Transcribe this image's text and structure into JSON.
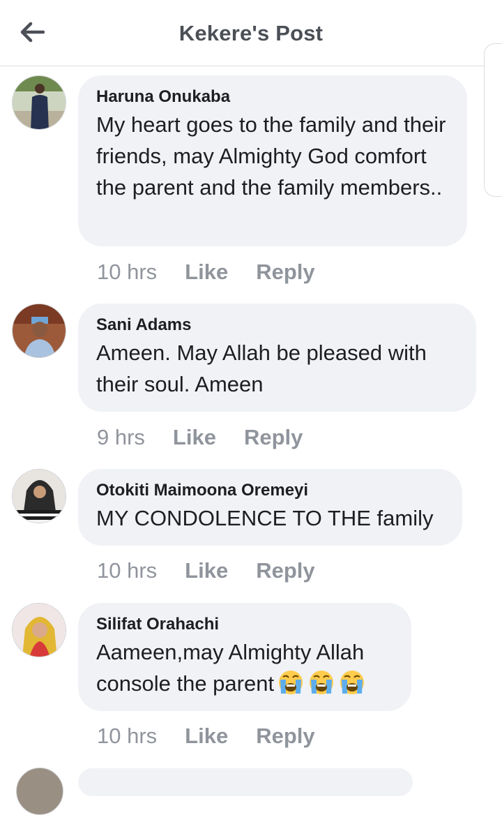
{
  "header": {
    "title": "Kekere's Post",
    "back_icon": "arrow-left-icon"
  },
  "actions": {
    "like": "Like",
    "reply": "Reply"
  },
  "comments": [
    {
      "name": "Haruna Onukaba",
      "text": "My heart goes to the family and their friends, may Almighty God comfort the parent and the family members..",
      "time": "10 hrs"
    },
    {
      "name": "Sani Adams",
      "text": "Ameen. May Allah be pleased with their soul. Ameen",
      "time": "9 hrs"
    },
    {
      "name": "Otokiti Maimoona Oremeyi",
      "text": "MY CONDOLENCE TO THE family",
      "time": "10 hrs"
    },
    {
      "name": "Silifat Orahachi",
      "text": "Aameen,may Almighty Allah console the parent",
      "emojis": [
        "loudly-crying-face",
        "loudly-crying-face",
        "loudly-crying-face"
      ],
      "time": "10 hrs"
    }
  ],
  "colors": {
    "bubble": "#f0f2f5",
    "meta": "#90949c",
    "title": "#4b4f56"
  }
}
